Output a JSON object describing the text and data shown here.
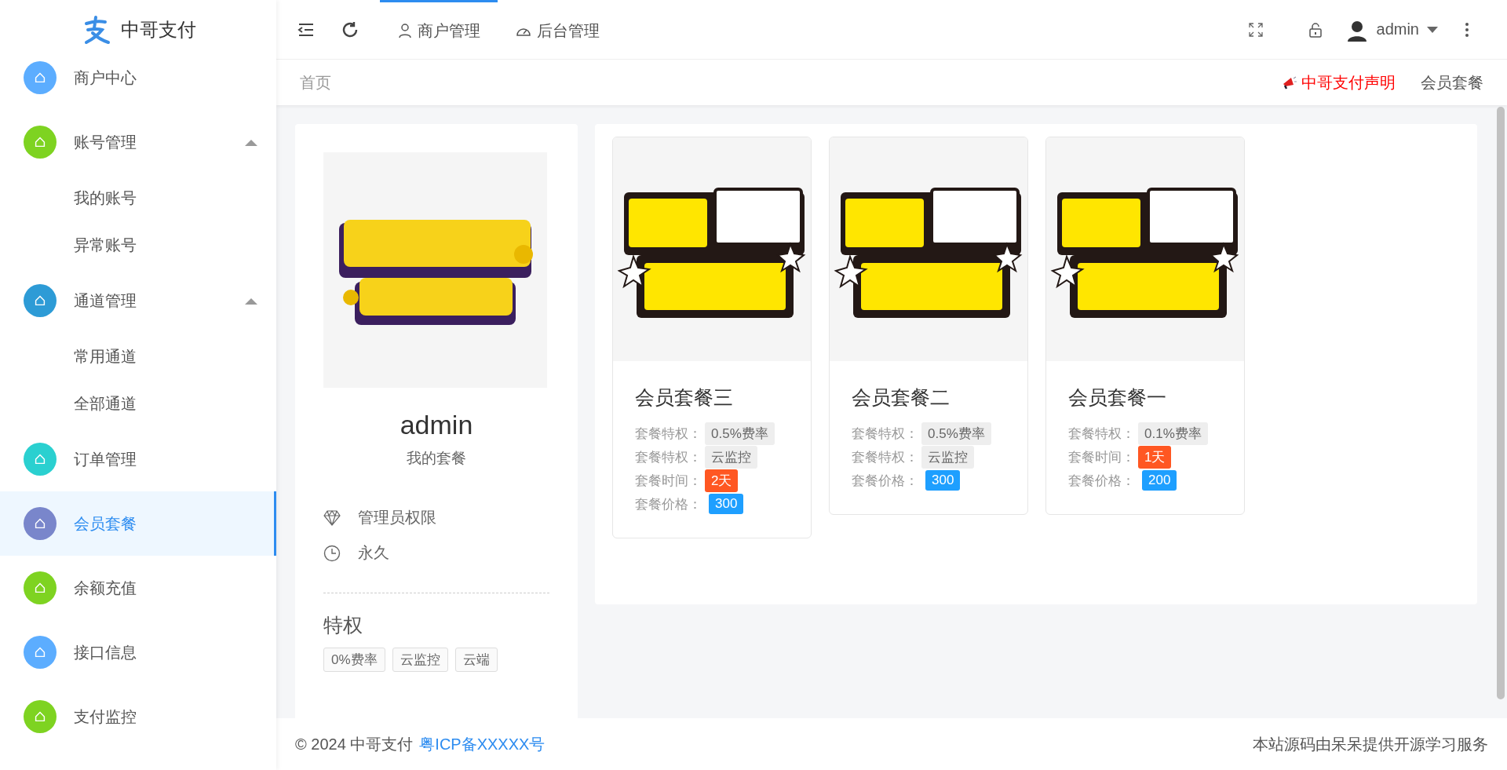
{
  "sidebar": {
    "logo": "中哥支付",
    "items": [
      {
        "label": "商户中心",
        "color": "#5cadff",
        "selected": false
      },
      {
        "label": "账号管理",
        "color": "#7ed321",
        "selected": false,
        "expanded": true,
        "children": [
          {
            "label": "我的账号",
            "selected": false
          },
          {
            "label": "异常账号",
            "selected": false
          }
        ]
      },
      {
        "label": "通道管理",
        "color": "#2d9bd6",
        "selected": false,
        "expanded": true,
        "children": [
          {
            "label": "常用通道",
            "selected": false
          },
          {
            "label": "全部通道",
            "selected": false
          }
        ]
      },
      {
        "label": "订单管理",
        "color": "#2ad0d0",
        "selected": false
      },
      {
        "label": "会员套餐",
        "color": "#7986cb",
        "selected": true
      },
      {
        "label": "余额充值",
        "color": "#7ed321",
        "selected": false
      },
      {
        "label": "接口信息",
        "color": "#5cadff",
        "selected": false
      },
      {
        "label": "支付监控",
        "color": "#7ed321",
        "selected": false
      }
    ]
  },
  "header": {
    "tabs": [
      {
        "label": "商户管理",
        "selected": true
      },
      {
        "label": "后台管理",
        "selected": false
      }
    ],
    "user": "admin"
  },
  "breadcrumb": {
    "path": "首页",
    "notice": "中哥支付声明",
    "link": "会员套餐"
  },
  "profile": {
    "name": "admin",
    "subtitle": "我的套餐",
    "role": "管理员权限",
    "duration": "永久",
    "privileges_title": "特权",
    "privileges": [
      "0%费率",
      "云监控",
      "云端"
    ]
  },
  "packages": [
    {
      "title": "会员套餐三",
      "rows": [
        {
          "label": "套餐特权：",
          "value": "0.5%费率",
          "kind": "privilege"
        },
        {
          "label": "套餐特权：",
          "value": "云监控",
          "kind": "privilege"
        },
        {
          "label": "套餐时间：",
          "value": "2天",
          "kind": "time"
        },
        {
          "label": "套餐价格：",
          "value": "300",
          "kind": "price"
        }
      ]
    },
    {
      "title": "会员套餐二",
      "rows": [
        {
          "label": "套餐特权：",
          "value": "0.5%费率",
          "kind": "privilege"
        },
        {
          "label": "套餐特权：",
          "value": "云监控",
          "kind": "privilege"
        },
        {
          "label": "套餐价格：",
          "value": "300",
          "kind": "price"
        }
      ]
    },
    {
      "title": "会员套餐一",
      "rows": [
        {
          "label": "套餐特权：",
          "value": "0.1%费率",
          "kind": "privilege"
        },
        {
          "label": "套餐时间：",
          "value": "1天",
          "kind": "time"
        },
        {
          "label": "套餐价格：",
          "value": "200",
          "kind": "price"
        }
      ]
    }
  ],
  "footer": {
    "copyright": "© 2024 中哥支付",
    "icp": "粤ICP备XXXXX号",
    "credit": "本站源码由呆呆提供开源学习服务"
  }
}
